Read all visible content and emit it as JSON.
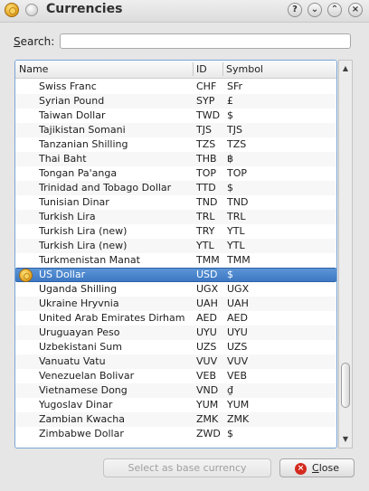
{
  "window": {
    "title": "Currencies",
    "controls": {
      "help": "?",
      "minimize": "⌄",
      "maximize": "⌃",
      "close": "×"
    }
  },
  "search": {
    "label_accel": "S",
    "label_rest": "earch:",
    "value": "",
    "placeholder": ""
  },
  "list": {
    "columns": [
      "Name",
      "ID",
      "Symbol"
    ],
    "rows": [
      {
        "name": "Swiss Franc",
        "id": "CHF",
        "symbol": "SFr"
      },
      {
        "name": "Syrian Pound",
        "id": "SYP",
        "symbol": "£"
      },
      {
        "name": "Taiwan Dollar",
        "id": "TWD",
        "symbol": "$"
      },
      {
        "name": "Tajikistan Somani",
        "id": "TJS",
        "symbol": "TJS"
      },
      {
        "name": "Tanzanian Shilling",
        "id": "TZS",
        "symbol": "TZS"
      },
      {
        "name": "Thai Baht",
        "id": "THB",
        "symbol": "฿"
      },
      {
        "name": "Tongan Pa'anga",
        "id": "TOP",
        "symbol": "TOP"
      },
      {
        "name": "Trinidad and Tobago Dollar",
        "id": "TTD",
        "symbol": "$"
      },
      {
        "name": "Tunisian Dinar",
        "id": "TND",
        "symbol": "TND"
      },
      {
        "name": "Turkish Lira",
        "id": "TRL",
        "symbol": "TRL"
      },
      {
        "name": "Turkish Lira (new)",
        "id": "TRY",
        "symbol": "YTL"
      },
      {
        "name": "Turkish Lira (new)",
        "id": "YTL",
        "symbol": "YTL"
      },
      {
        "name": "Turkmenistan Manat",
        "id": "TMM",
        "symbol": "TMM"
      },
      {
        "name": "US Dollar",
        "id": "USD",
        "symbol": "$",
        "selected": true,
        "base": true
      },
      {
        "name": "Uganda Shilling",
        "id": "UGX",
        "symbol": "UGX"
      },
      {
        "name": "Ukraine Hryvnia",
        "id": "UAH",
        "symbol": "UAH"
      },
      {
        "name": "United Arab Emirates Dirham",
        "id": "AED",
        "symbol": "AED"
      },
      {
        "name": "Uruguayan Peso",
        "id": "UYU",
        "symbol": "UYU"
      },
      {
        "name": "Uzbekistani Sum",
        "id": "UZS",
        "symbol": "UZS"
      },
      {
        "name": "Vanuatu Vatu",
        "id": "VUV",
        "symbol": "VUV"
      },
      {
        "name": "Venezuelan Bolivar",
        "id": "VEB",
        "symbol": "VEB"
      },
      {
        "name": "Vietnamese Dong",
        "id": "VND",
        "symbol": "₫"
      },
      {
        "name": "Yugoslav Dinar",
        "id": "YUM",
        "symbol": "YUM"
      },
      {
        "name": "Zambian Kwacha",
        "id": "ZMK",
        "symbol": "ZMK"
      },
      {
        "name": "Zimbabwe Dollar",
        "id": "ZWD",
        "symbol": "$"
      }
    ]
  },
  "scrollbar": {
    "up_arrow": "▲",
    "down_arrow": "▼",
    "position": 0.92
  },
  "buttons": {
    "set_base": "Select as base currency",
    "close_accel": "C",
    "close_rest": "lose",
    "close_icon": "×"
  },
  "colors": {
    "selection": "#4a86cf",
    "frame_focus": "#7aa6d6"
  }
}
